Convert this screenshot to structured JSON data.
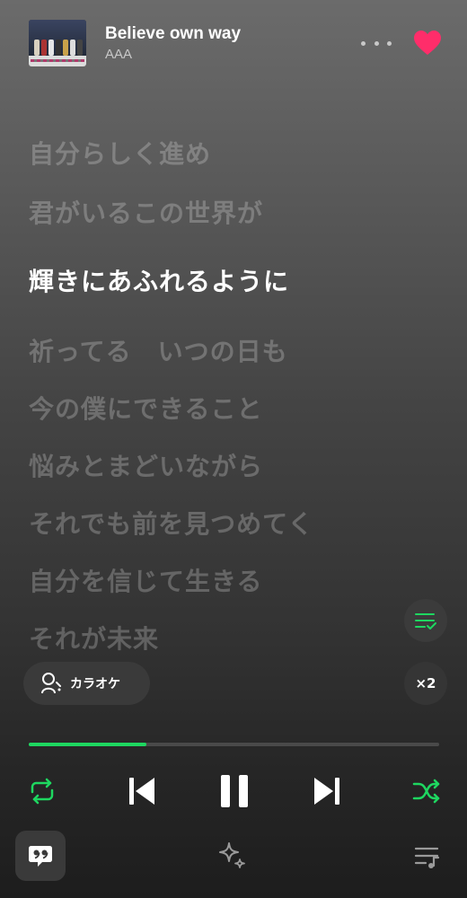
{
  "track": {
    "title": "Believe own way",
    "artist": "AAA",
    "liked": true
  },
  "lyrics": [
    {
      "text": "自分らしく進め",
      "active": false
    },
    {
      "text": "君がいるこの世界が",
      "active": false
    },
    {
      "text": "輝きにあふれるように",
      "active": true
    },
    {
      "text": "祈ってる　いつの日も",
      "active": false
    },
    {
      "text": "今の僕にできること",
      "active": false
    },
    {
      "text": "悩みとまどいながら",
      "active": false
    },
    {
      "text": "それでも前を見つめてく",
      "active": false
    },
    {
      "text": "自分を信じて生きる",
      "active": false
    },
    {
      "text": "それが未来",
      "active": false
    }
  ],
  "karaoke": {
    "label": "カラオケ",
    "icon": "karaoke-mic-icon"
  },
  "speed": {
    "label": "×2"
  },
  "progress": {
    "fraction": 0.286
  },
  "icons": {
    "more": "more-icon",
    "heart": "heart-icon",
    "queue": "queue-check-icon",
    "repeat": "repeat-icon",
    "prev": "skip-previous-icon",
    "pause": "pause-icon",
    "next": "skip-next-icon",
    "shuffle": "shuffle-icon",
    "lyrics": "lyrics-quote-icon",
    "sparkle": "sparkle-icon",
    "playlist": "playlist-icon"
  },
  "colors": {
    "accent": "#1ed760",
    "heart": "#ff2d6a",
    "active_lyric": "#ffffff",
    "inactive_lyric": "rgba(255,255,255,0.23)"
  }
}
